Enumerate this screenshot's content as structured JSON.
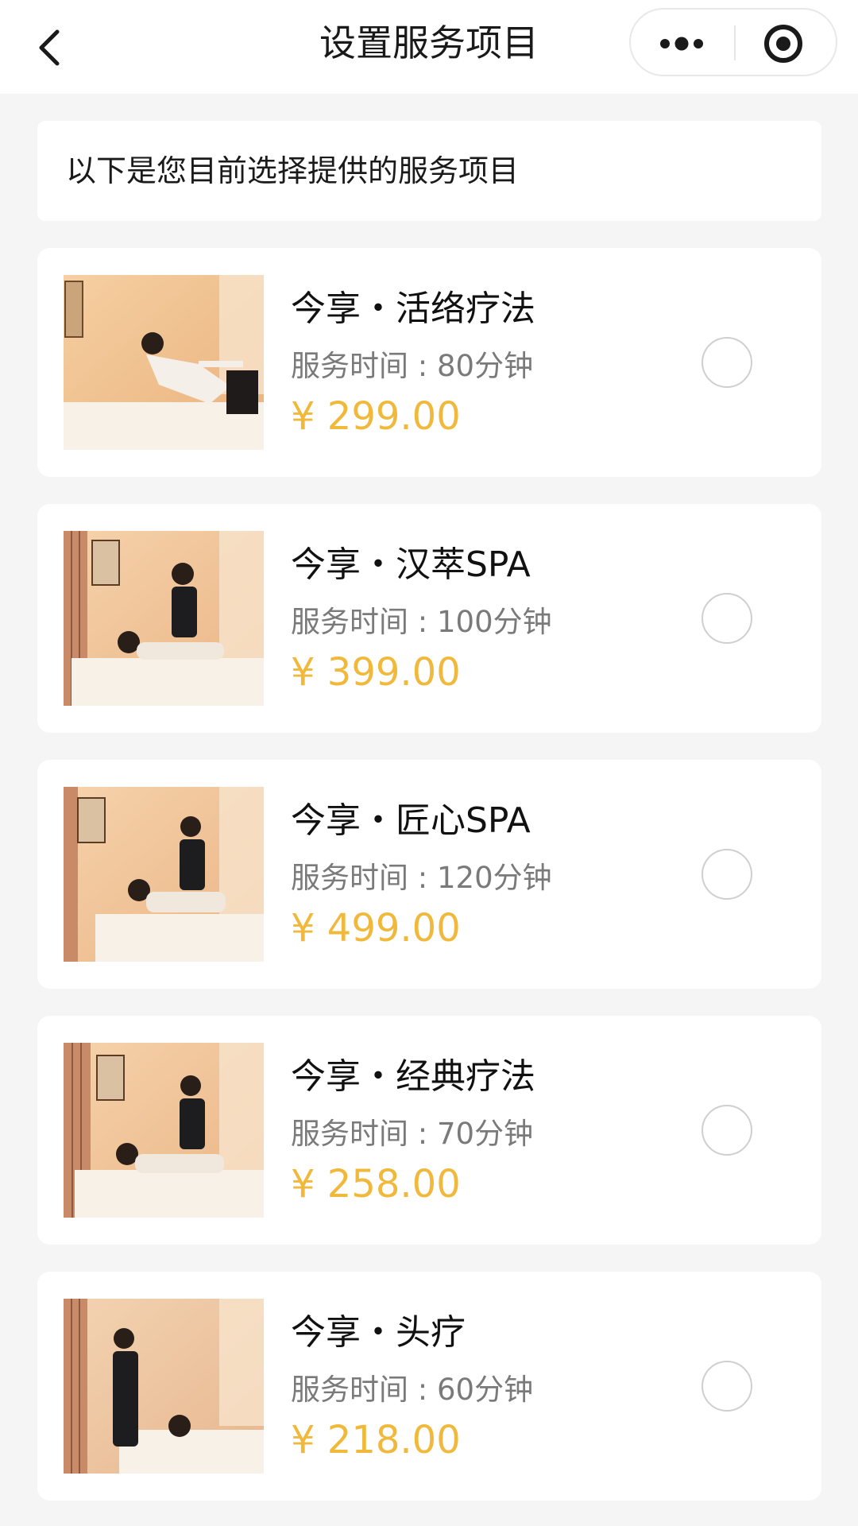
{
  "navbar": {
    "title": "设置服务项目",
    "back_icon": "chevron-left-icon",
    "more_icon": "more-dots-icon",
    "close_icon": "target-circle-icon"
  },
  "notice": {
    "text": "以下是您目前选择提供的服务项目"
  },
  "theme": {
    "price_color": "#f0b93c",
    "background": "#f5f5f5"
  },
  "services": [
    {
      "name": "今享・活络疗法",
      "duration": "服务时间 : 80分钟",
      "price": "¥ 299.00",
      "selected": false
    },
    {
      "name": "今享・汉萃SPA",
      "duration": "服务时间 : 100分钟",
      "price": "¥ 399.00",
      "selected": false
    },
    {
      "name": "今享・匠心SPA",
      "duration": "服务时间 : 120分钟",
      "price": "¥ 499.00",
      "selected": false
    },
    {
      "name": "今享・经典疗法",
      "duration": "服务时间 : 70分钟",
      "price": "¥ 258.00",
      "selected": false
    },
    {
      "name": "今享・头疗",
      "duration": "服务时间 : 60分钟",
      "price": "¥ 218.00",
      "selected": false
    }
  ]
}
